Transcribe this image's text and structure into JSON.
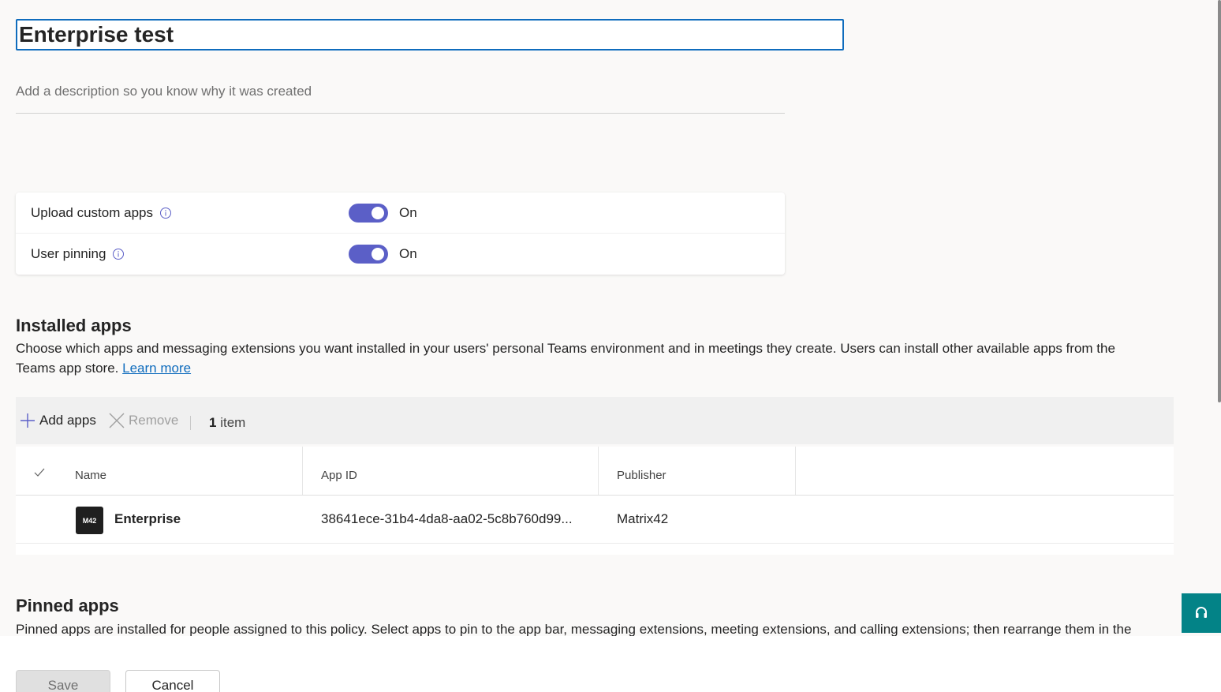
{
  "policy": {
    "name": "Enterprise test",
    "description_placeholder": "Add a description so you know why it was created"
  },
  "settings": [
    {
      "label": "Upload custom apps",
      "state": "On",
      "enabled": true
    },
    {
      "label": "User pinning",
      "state": "On",
      "enabled": true
    }
  ],
  "installed_apps": {
    "title": "Installed apps",
    "description": "Choose which apps and messaging extensions you want installed in your users' personal Teams environment and in meetings they create. Users can install other available apps from the Teams app store.",
    "learn_more": "Learn more",
    "toolbar": {
      "add_label": "Add apps",
      "remove_label": "Remove",
      "count_number": "1",
      "count_unit": "item"
    },
    "columns": [
      "Name",
      "App ID",
      "Publisher"
    ],
    "rows": [
      {
        "name": "Enterprise",
        "app_id": "38641ece-31b4-4da8-aa02-5c8b760d99...",
        "publisher": "Matrix42",
        "logo_text": "M42"
      }
    ]
  },
  "pinned_apps": {
    "title": "Pinned apps",
    "description": "Pinned apps are installed for people assigned to this policy. Select apps to pin to the app bar, messaging extensions, meeting extensions, and calling extensions; then rearrange them in the"
  },
  "footer": {
    "save_label": "Save",
    "cancel_label": "Cancel"
  },
  "colors": {
    "toggle_on": "#5b5fc7",
    "accent": "#0f6cbd",
    "help_button": "#038387"
  },
  "icons": {
    "info": "info-icon",
    "add": "plus-icon",
    "remove": "close-icon",
    "select_all": "checkmark-icon",
    "help": "headset-icon"
  }
}
